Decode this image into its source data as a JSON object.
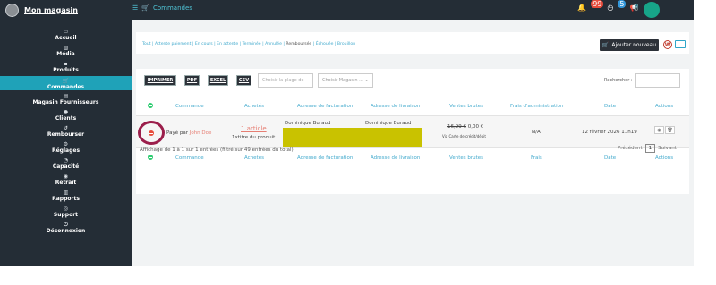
{
  "app": {
    "brand": "Mon magasin",
    "breadcrumb": "Commandes"
  },
  "topbar": {
    "icons": [
      "bell-icon",
      "clock-icon",
      "megaphone-icon",
      "clipboard-icon"
    ],
    "notif_badge": "99",
    "clock_badge": "5",
    "colors": {
      "bar": "#242d36",
      "accent": "#1fa2b8",
      "avatar": "#17a589"
    }
  },
  "sidebar": {
    "items": [
      {
        "label": "Accueil",
        "icon": "laptop-icon"
      },
      {
        "label": "Média",
        "icon": "image-icon"
      },
      {
        "label": "Produits",
        "icon": "box-icon"
      },
      {
        "label": "Commandes",
        "icon": "cart-icon",
        "active": true
      },
      {
        "label": "Magasin Fournisseurs",
        "icon": "store-icon"
      },
      {
        "label": "Clients",
        "icon": "user-icon"
      },
      {
        "label": "Rembourser",
        "icon": "refund-icon"
      },
      {
        "label": "Réglages",
        "icon": "gear-icon"
      },
      {
        "label": "Capacité",
        "icon": "capacity-icon"
      },
      {
        "label": "Retrait",
        "icon": "pickup-icon"
      },
      {
        "label": "Rapports",
        "icon": "chart-icon"
      },
      {
        "label": "Support",
        "icon": "support-icon"
      },
      {
        "label": "Déconnexion",
        "icon": "logout-icon"
      }
    ]
  },
  "status_filters": [
    "Tout",
    "Attente paiement",
    "En cours",
    "En attente",
    "Terminée",
    "Annulée",
    "Remboursée",
    "Échouée",
    "Brouillon"
  ],
  "add_button": "Ajouter nouveau",
  "toolbar": {
    "buttons": [
      "IMPRIMER",
      "PDF",
      "EXCEL",
      "CSV"
    ],
    "date_placeholder": "Choisir la plage de",
    "store_select": "Choisir Magasin ...",
    "search_label": "Rechercher :"
  },
  "table": {
    "headers": [
      "Commande",
      "Achetés",
      "Adresse de facturation",
      "Adresse de livraison",
      "Ventes brutes",
      "Frais d'administration",
      "Date",
      "Actions"
    ],
    "footer_headers": [
      "Commande",
      "Achetés",
      "Adresse de facturation",
      "Adresse de livraison",
      "Ventes brutes",
      "Frais",
      "Date",
      "Actions"
    ],
    "row": {
      "order_prefix": "Payé par",
      "customer": "John Doe",
      "purchased_link": "1 article",
      "purchased_detail": "1xtitre du produit",
      "billing_name": "Dominique Buraud",
      "shipping_name": "Dominique Buraud",
      "price_old": "16,99 €",
      "price_new": "0,00 €",
      "payment_method": "Via Carte de crédit/débit",
      "admin_fee": "N/A",
      "date": "12 février 2026 11h19"
    }
  },
  "footer": {
    "info": "Affichage de 1 à 1 sur 1 entrées (filtré sur 49 entrées du total)",
    "prev": "Précédent",
    "page": "1",
    "next": "Suivant"
  }
}
